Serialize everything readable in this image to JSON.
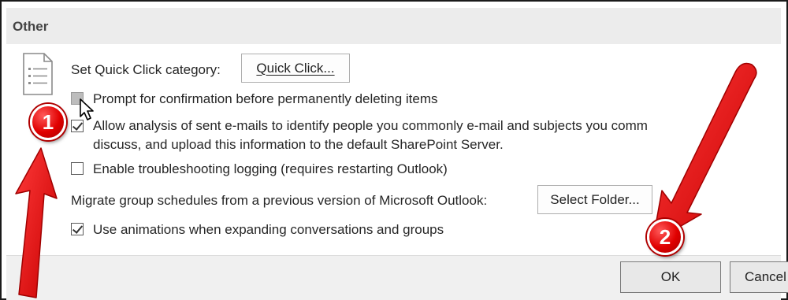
{
  "section": {
    "title": "Other"
  },
  "quick_click": {
    "label": "Set Quick Click category:",
    "button": "Quick Click..."
  },
  "options": [
    {
      "label": "Prompt for confirmation before permanently deleting items",
      "checked": false,
      "disabled": true
    },
    {
      "label_line1": "Allow analysis of sent e-mails to identify people you commonly e-mail and subjects you comm",
      "label_line2": "discuss, and upload this information to the default SharePoint Server.",
      "checked": true
    },
    {
      "label": "Enable troubleshooting logging (requires restarting Outlook)",
      "checked": false
    },
    {
      "label": "Use animations when expanding conversations and groups",
      "checked": true
    }
  ],
  "migrate": {
    "label": "Migrate group schedules from a previous version of Microsoft Outlook:",
    "button": "Select Folder..."
  },
  "footer": {
    "ok": "OK",
    "cancel": "Cancel"
  },
  "annotations": {
    "badge1": "1",
    "badge2": "2",
    "arrow_color": "#e60000"
  },
  "icons": {
    "document": "document-list-icon",
    "cursor": "mouse-pointer-icon"
  }
}
